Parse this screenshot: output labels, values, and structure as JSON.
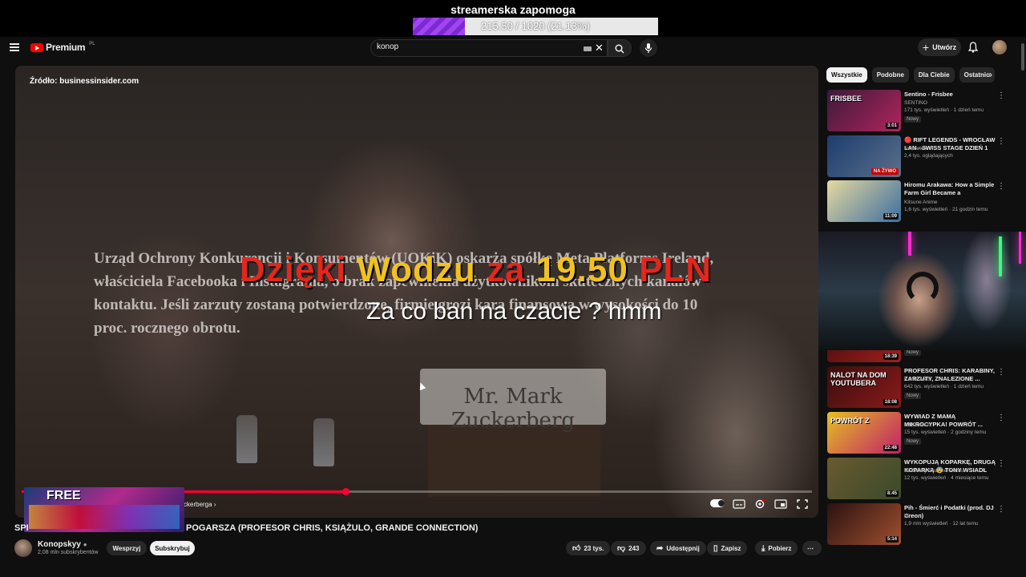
{
  "overlay": {
    "goal_title": "streamerska zapomoga",
    "goal_text": "215.50 / 1020 (21.13%)",
    "goal_progress": 0.2113,
    "donation_parts": [
      "Dzięki",
      "Wodzu",
      "za",
      "19.50",
      "PLN"
    ],
    "donation_message": "Za co ban na czacie ? hmm"
  },
  "header": {
    "brand": "Premium",
    "brand_region": "PL",
    "search_value": "konop",
    "create_label": "Utwórz"
  },
  "video": {
    "source_label": "Źródło: businessinsider.com",
    "news_text": "Urząd Ochrony Konkurencji i Konsumentów (UOKiK) oskarża spółkę Meta Platforms Ireland, właściciela Facebooka i Instagrama, o brak zapewnienia użytkownikom skutecznych kanałów kontaktu. Jeśli zarzuty zostaną potwierdzone, firmie grozi kara finansowa w wysokości do 10 proc. rocznego obrotu.",
    "nameplate": "Mr. Mark Zuckerberg",
    "chapter": "ckerberga",
    "progress": 0.41,
    "overlay_game_text": "FREE"
  },
  "info": {
    "title_prefix": "SPI",
    "title_rest": "POGARSZA (PROFESOR CHRIS, KSIĄŻULO, GRANDE CONNECTION)",
    "channel_name": "Konopskyy",
    "channel_subs": "2,08 mln subskrybentów",
    "support_label": "Wesprzyj",
    "subscribe_label": "Subskrybuj",
    "likes": "23 tys.",
    "dislikes": "243",
    "share_label": "Udostępnij",
    "save_label": "Zapisz",
    "download_label": "Pobierz"
  },
  "chips": [
    "Wszystkie",
    "Podobne",
    "Dla Ciebie",
    "Ostatnio"
  ],
  "recommendations": [
    {
      "title": "Sentino - Frisbee",
      "channel": "SENTINO",
      "meta": "171 tys. wyświetleń · 1 dzień temu",
      "badge": "Nowy",
      "duration": "3:01",
      "thumb_text": "FRISBEE",
      "c1": "#3b1a3a",
      "c2": "#b0245c"
    },
    {
      "title": "🔴 RIFT LEGENDS - WROCŁAW LAN - SWISS STAGE DZIEŃ 1 🔴",
      "channel": "Nervarien",
      "meta": "2,4 tys. oglądających",
      "badge": "",
      "duration": "NA ŻYWO",
      "thumb_text": "",
      "c1": "#1d3d6e",
      "c2": "#5a6f8a"
    },
    {
      "title": "Hiromu Arakawa: How a Simple Farm Girl Became a Legendary...",
      "channel": "Kitsune Anime",
      "meta": "1,6 tys. wyświetleń · 21 godzin temu",
      "badge": "",
      "duration": "11:09",
      "thumb_text": "",
      "c1": "#e5d9a0",
      "c2": "#3d6ea0"
    },
    {
      "title": "",
      "channel": "",
      "meta": "",
      "badge": "Nowy",
      "duration": "18:39",
      "thumb_text": "",
      "c1": "#5a1010",
      "c2": "#a02020"
    },
    {
      "title": "PROFESOR CHRIS: KARABINY, ZARZUTY, ZNALEZIONE ...",
      "channel": "Kanał Zero",
      "meta": "642 tys. wyświetleń · 1 dzień temu",
      "badge": "Nowy",
      "duration": "18:08",
      "thumb_text": "NALOT NA DOM YOUTUBERA",
      "c1": "#3a0e0e",
      "c2": "#8a1a1a"
    },
    {
      "title": "WYWIAD Z MAMĄ MIKROCYPKA! POWRÓT ...",
      "channel": "SzklanaYJJ",
      "meta": "15 tys. wyświetleń · 2 godziny temu",
      "badge": "Nowy",
      "duration": "22:48",
      "thumb_text": "POWRÓT Z",
      "c1": "#e6c020",
      "c2": "#c0206a"
    },
    {
      "title": "WYKOPUJĄ KOPARKĘ, DRUGĄ KOPARKĄ 😨 TONY WSIADŁ Z...",
      "channel": "Discovery Channel Polska",
      "meta": "12 tys. wyświetleń · 4 miesiące temu",
      "badge": "",
      "duration": "8:45",
      "thumb_text": "",
      "c1": "#6a5a30",
      "c2": "#3a4a2a"
    },
    {
      "title": "Pih - Śmierć i Podatki (prod. DJ Creon)",
      "channel": "Pih",
      "meta": "1,9 mln wyświetleń · 12 lat temu",
      "badge": "",
      "duration": "5:14",
      "thumb_text": "",
      "c1": "#2a1210",
      "c2": "#a05030"
    }
  ],
  "colors": {
    "accent_red": "#ff0033",
    "goal_purple": "#8a35e0",
    "donation_red": "#e1271e",
    "donation_yellow": "#f0c21e"
  }
}
